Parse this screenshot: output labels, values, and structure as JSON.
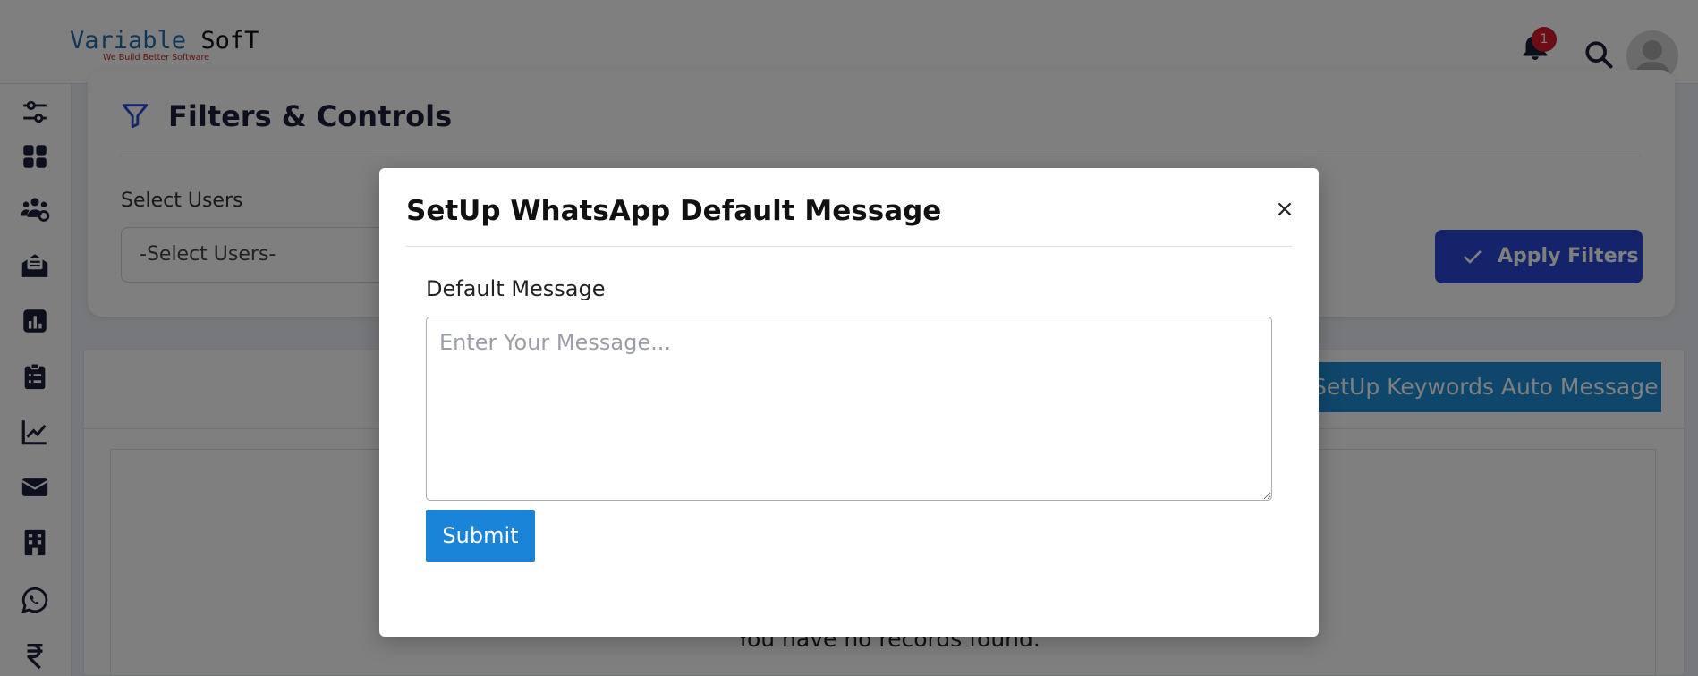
{
  "header": {
    "logo": {
      "variable": "Variable",
      "soft": "SofT",
      "tagline": "We Build Better Software"
    },
    "notification_count": "1",
    "icons": [
      "bell-icon",
      "search-icon",
      "user-avatar-icon"
    ]
  },
  "sidebar": {
    "icons": [
      "sliders-icon",
      "dashboard-icon",
      "users-cog-icon",
      "mail-open-icon",
      "chart-bar-icon",
      "clipboard-icon",
      "line-chart-icon",
      "envelope-icon",
      "building-icon",
      "whatsapp-icon",
      "rupee-icon"
    ]
  },
  "filters": {
    "title": "Filters & Controls",
    "select_users_label": "Select Users",
    "select_users_value": "-Select Users-",
    "apply_label": "Apply Filters"
  },
  "panel": {
    "keywords_button": "SetUp Keywords Auto Message",
    "empty_text": "You have no records found."
  },
  "modal": {
    "title": "SetUp WhatsApp Default Message",
    "close_label": "×",
    "field_label": "Default Message",
    "placeholder": "Enter Your Message...",
    "submit_label": "Submit"
  },
  "colors": {
    "primary": "#2a46d6",
    "accent": "#1e8fd8",
    "badge": "#d81b2b"
  }
}
